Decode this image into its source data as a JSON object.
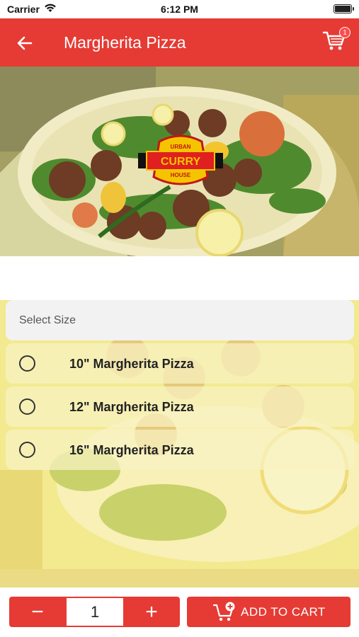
{
  "status_bar": {
    "carrier": "Carrier",
    "time": "6:12 PM"
  },
  "header": {
    "title": "Margherita Pizza",
    "cart_count": "1"
  },
  "hero": {
    "logo_text": [
      "URBAN",
      "CURRY",
      "HOUSE"
    ]
  },
  "size_selector": {
    "header": "Select Size",
    "options": [
      {
        "label": "10\" Margherita Pizza",
        "selected": false
      },
      {
        "label": "12\" Margherita Pizza",
        "selected": false
      },
      {
        "label": "16\" Margherita Pizza",
        "selected": false
      }
    ]
  },
  "footer": {
    "minus": "−",
    "plus": "+",
    "quantity": "1",
    "add_to_cart": "ADD TO CART"
  },
  "colors": {
    "brand_red": "#e53b34",
    "overlay_yellow": "#f2e78e"
  }
}
